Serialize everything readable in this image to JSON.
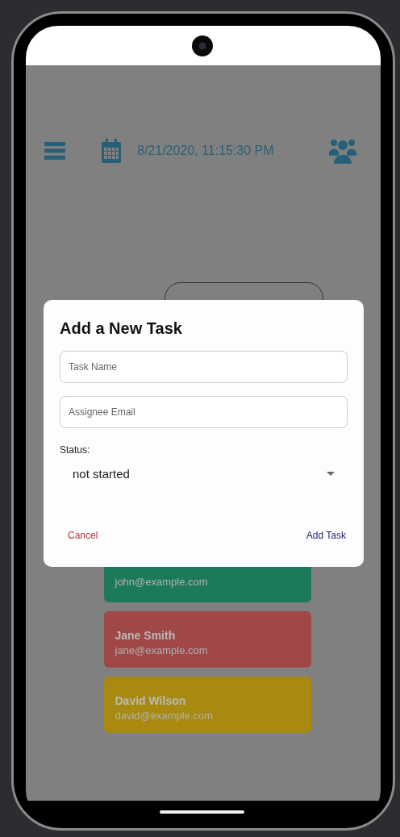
{
  "header": {
    "datetime": "8/21/2020, 11:15:30 PM"
  },
  "cards": [
    {
      "email": "john@example.com",
      "color": "#1d7a58"
    },
    {
      "name": "Jane Smith",
      "email": "jane@example.com",
      "color": "#a04747"
    },
    {
      "name": "David Wilson",
      "email": "david@example.com",
      "color": "#a88a10"
    }
  ],
  "dialog": {
    "title": "Add a New Task",
    "fields": [
      {
        "placeholder": "Task Name"
      },
      {
        "placeholder": "Assignee Email"
      }
    ],
    "status_label": "Status:",
    "status_value": "not started",
    "buttons": [
      {
        "label": "Cancel",
        "kind": "cancel"
      },
      {
        "label": "Add Task",
        "kind": "confirm"
      }
    ]
  }
}
